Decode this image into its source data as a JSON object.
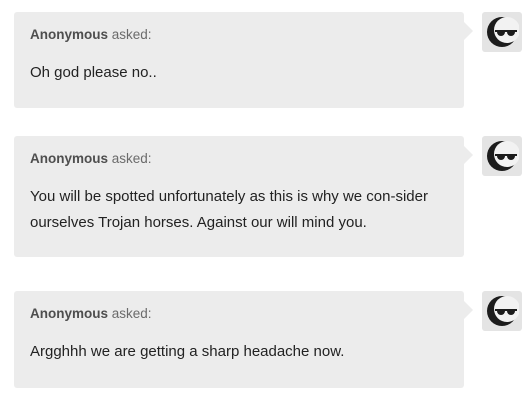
{
  "asks": [
    {
      "asker": "Anonymous",
      "asked_label": "asked:",
      "question": "Oh god please no..",
      "avatar_icon": "anonymous-sunglasses-moon-icon"
    },
    {
      "asker": "Anonymous",
      "asked_label": "asked:",
      "question": "You will be spotted unfortunately as this is why we con-sider ourselves Trojan horses. Against our will mind you.",
      "avatar_icon": "anonymous-sunglasses-moon-icon"
    },
    {
      "asker": "Anonymous",
      "asked_label": "asked:",
      "question": "Argghhh we are getting a sharp headache now.",
      "avatar_icon": "anonymous-sunglasses-moon-icon"
    }
  ],
  "colors": {
    "bubble_bg": "#ececec",
    "text": "#222222",
    "meta": "#5b5b5b"
  }
}
